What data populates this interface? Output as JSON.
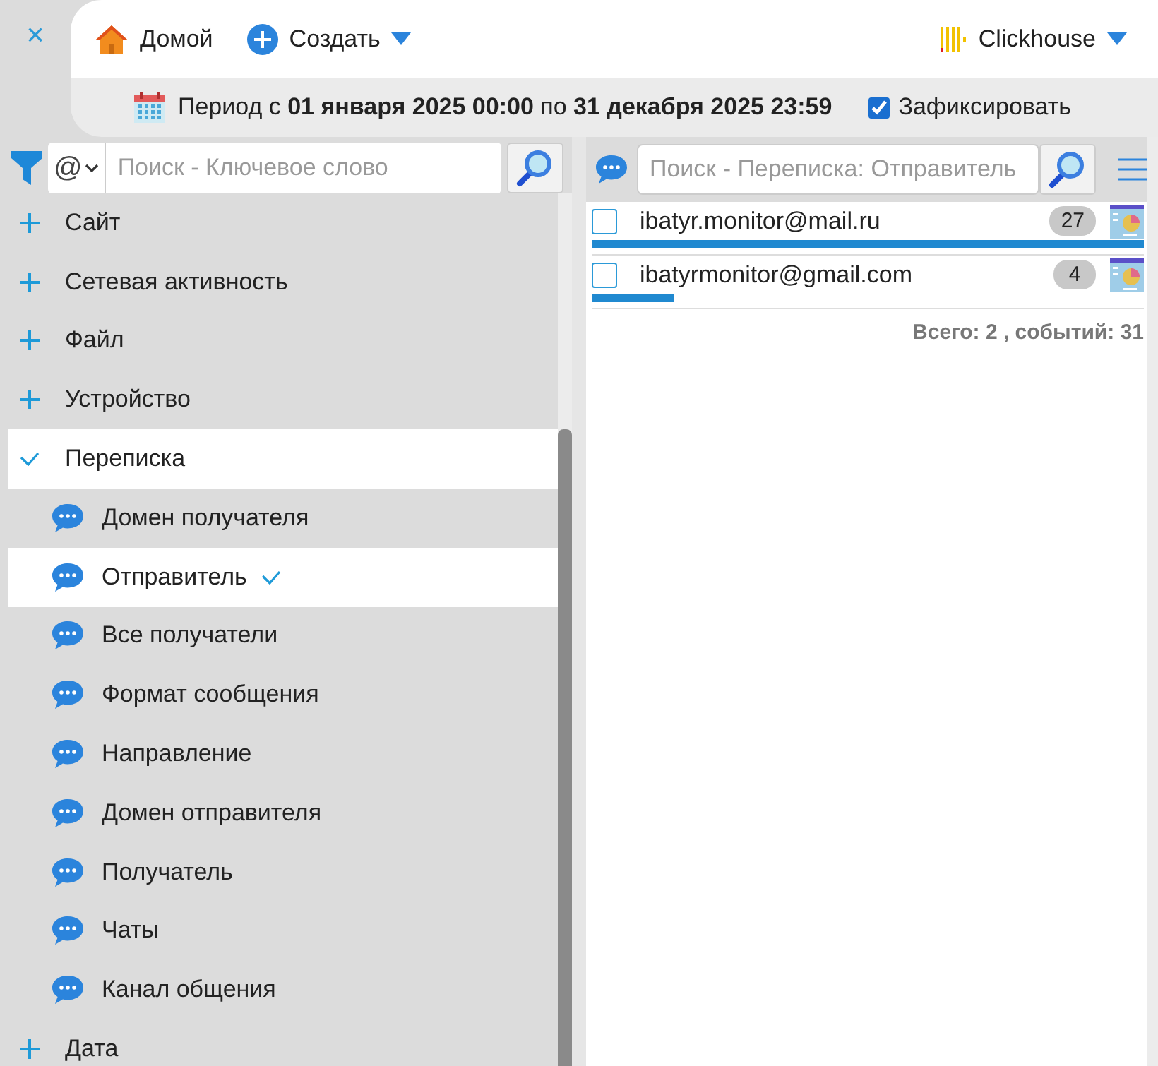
{
  "header": {
    "close": "×",
    "home": "Домой",
    "create": "Создать",
    "database": "Clickhouse"
  },
  "period": {
    "text": "Период с **01 января 2025 00:00** по **31 декабря 2025 23:59**",
    "fix_label": "Зафиксировать",
    "fix_checked": true
  },
  "left_search": {
    "mode": "@",
    "placeholder": "Поиск - Ключевое слово"
  },
  "tree": [
    {
      "label": "Сайт",
      "expanded": false
    },
    {
      "label": "Сетевая активность",
      "expanded": false
    },
    {
      "label": "Файл",
      "expanded": false
    },
    {
      "label": "Устройство",
      "expanded": false
    },
    {
      "label": "Переписка",
      "expanded": true,
      "children": [
        {
          "label": "Домен получателя",
          "selected": false
        },
        {
          "label": "Отправитель",
          "selected": true
        },
        {
          "label": "Все получатели",
          "selected": false
        },
        {
          "label": "Формат сообщения",
          "selected": false
        },
        {
          "label": "Направление",
          "selected": false
        },
        {
          "label": "Домен отправителя",
          "selected": false
        },
        {
          "label": "Получатель",
          "selected": false
        },
        {
          "label": "Чаты",
          "selected": false
        },
        {
          "label": "Канал общения",
          "selected": false
        }
      ]
    },
    {
      "label": "Дата",
      "expanded": false
    }
  ],
  "right_search": {
    "placeholder": "Поиск - Переписка: Отправитель"
  },
  "results": [
    {
      "value": "ibatyr.monitor@mail.ru",
      "count": "27",
      "checked": false,
      "level": 1
    },
    {
      "value": "ibatyrmonitor@gmail.com",
      "count": "4",
      "checked": false,
      "level": 0.148
    }
  ],
  "summary": "Всего: 2 , событий: 31"
}
